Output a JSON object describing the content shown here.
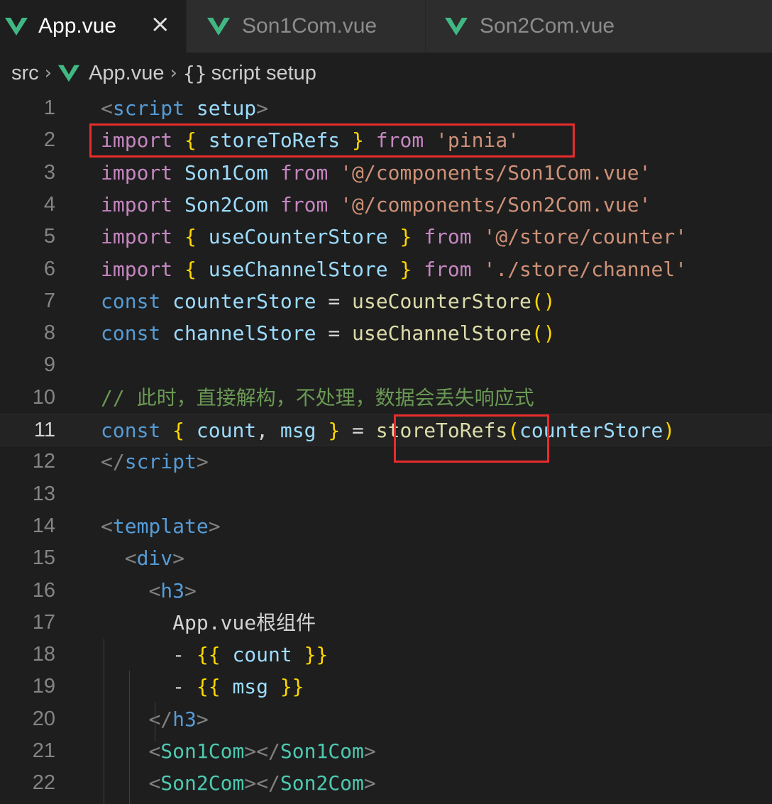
{
  "tabs": [
    {
      "label": "App.vue",
      "active": true,
      "close": "×"
    },
    {
      "label": "Son1Com.vue",
      "active": false
    },
    {
      "label": "Son2Com.vue",
      "active": false
    }
  ],
  "breadcrumb": {
    "folder": "src",
    "file": "App.vue",
    "symbol_icon": "{}",
    "symbol": "script setup"
  },
  "colors": {
    "vue_green": "#41b883",
    "highlight_box": "#e82b2b",
    "editor_bg": "#1e1e1e"
  },
  "lines": [
    {
      "n": "1",
      "tokens": [
        [
          "t-p",
          "<"
        ],
        [
          "t-tg",
          "script"
        ],
        [
          "t-tx",
          " "
        ],
        [
          "t-at",
          "setup"
        ],
        [
          "t-p",
          ">"
        ]
      ]
    },
    {
      "n": "2",
      "tokens": [
        [
          "t-kw",
          "import"
        ],
        [
          "t-tx",
          " "
        ],
        [
          "t-br",
          "{"
        ],
        [
          "t-tx",
          " "
        ],
        [
          "t-vr",
          "storeToRefs"
        ],
        [
          "t-tx",
          " "
        ],
        [
          "t-br",
          "}"
        ],
        [
          "t-tx",
          " "
        ],
        [
          "t-kw",
          "from"
        ],
        [
          "t-tx",
          " "
        ],
        [
          "t-str",
          "'pinia'"
        ]
      ]
    },
    {
      "n": "3",
      "tokens": [
        [
          "t-kw",
          "import"
        ],
        [
          "t-tx",
          " "
        ],
        [
          "t-vr",
          "Son1Com"
        ],
        [
          "t-tx",
          " "
        ],
        [
          "t-kw",
          "from"
        ],
        [
          "t-tx",
          " "
        ],
        [
          "t-str",
          "'@/components/Son1Com.vue'"
        ]
      ]
    },
    {
      "n": "4",
      "tokens": [
        [
          "t-kw",
          "import"
        ],
        [
          "t-tx",
          " "
        ],
        [
          "t-vr",
          "Son2Com"
        ],
        [
          "t-tx",
          " "
        ],
        [
          "t-kw",
          "from"
        ],
        [
          "t-tx",
          " "
        ],
        [
          "t-str",
          "'@/components/Son2Com.vue'"
        ]
      ]
    },
    {
      "n": "5",
      "tokens": [
        [
          "t-kw",
          "import"
        ],
        [
          "t-tx",
          " "
        ],
        [
          "t-br",
          "{"
        ],
        [
          "t-tx",
          " "
        ],
        [
          "t-vr",
          "useCounterStore"
        ],
        [
          "t-tx",
          " "
        ],
        [
          "t-br",
          "}"
        ],
        [
          "t-tx",
          " "
        ],
        [
          "t-kw",
          "from"
        ],
        [
          "t-tx",
          " "
        ],
        [
          "t-str",
          "'@/store/counter'"
        ]
      ]
    },
    {
      "n": "6",
      "tokens": [
        [
          "t-kw",
          "import"
        ],
        [
          "t-tx",
          " "
        ],
        [
          "t-br",
          "{"
        ],
        [
          "t-tx",
          " "
        ],
        [
          "t-vr",
          "useChannelStore"
        ],
        [
          "t-tx",
          " "
        ],
        [
          "t-br",
          "}"
        ],
        [
          "t-tx",
          " "
        ],
        [
          "t-kw",
          "from"
        ],
        [
          "t-tx",
          " "
        ],
        [
          "t-str",
          "'./store/channel'"
        ]
      ]
    },
    {
      "n": "7",
      "tokens": [
        [
          "t-cs",
          "const"
        ],
        [
          "t-tx",
          " "
        ],
        [
          "t-vr",
          "counterStore"
        ],
        [
          "t-tx",
          " "
        ],
        [
          "t-op",
          "="
        ],
        [
          "t-tx",
          " "
        ],
        [
          "t-fn",
          "useCounterStore"
        ],
        [
          "t-br",
          "()"
        ]
      ]
    },
    {
      "n": "8",
      "tokens": [
        [
          "t-cs",
          "const"
        ],
        [
          "t-tx",
          " "
        ],
        [
          "t-vr",
          "channelStore"
        ],
        [
          "t-tx",
          " "
        ],
        [
          "t-op",
          "="
        ],
        [
          "t-tx",
          " "
        ],
        [
          "t-fn",
          "useChannelStore"
        ],
        [
          "t-br",
          "()"
        ]
      ]
    },
    {
      "n": "9",
      "tokens": []
    },
    {
      "n": "10",
      "tokens": [
        [
          "t-cm",
          "// 此时，直接解构，不处理，数据会丢失响应式"
        ]
      ]
    },
    {
      "n": "11",
      "current": true,
      "tokens": [
        [
          "t-cs",
          "const"
        ],
        [
          "t-tx",
          " "
        ],
        [
          "t-br",
          "{"
        ],
        [
          "t-tx",
          " "
        ],
        [
          "t-vr",
          "count"
        ],
        [
          "t-tx",
          ", "
        ],
        [
          "t-vr",
          "msg"
        ],
        [
          "t-tx",
          " "
        ],
        [
          "t-br",
          "}"
        ],
        [
          "t-tx",
          " "
        ],
        [
          "t-op",
          "="
        ],
        [
          "t-tx",
          " "
        ],
        [
          "t-fn",
          "storeToRefs"
        ],
        [
          "t-br",
          "("
        ],
        [
          "t-vr",
          "counterStore"
        ],
        [
          "t-br",
          ")"
        ]
      ]
    },
    {
      "n": "12",
      "tokens": [
        [
          "t-p",
          "</"
        ],
        [
          "t-tg",
          "script"
        ],
        [
          "t-p",
          ">"
        ]
      ]
    },
    {
      "n": "13",
      "tokens": []
    },
    {
      "n": "14",
      "tokens": [
        [
          "t-p",
          "<"
        ],
        [
          "t-tg",
          "template"
        ],
        [
          "t-p",
          ">"
        ]
      ]
    },
    {
      "n": "15",
      "tokens": [
        [
          "t-tx",
          "  "
        ],
        [
          "t-p",
          "<"
        ],
        [
          "t-tg",
          "div"
        ],
        [
          "t-p",
          ">"
        ]
      ]
    },
    {
      "n": "16",
      "tokens": [
        [
          "t-tx",
          "    "
        ],
        [
          "t-p",
          "<"
        ],
        [
          "t-tg",
          "h3"
        ],
        [
          "t-p",
          ">"
        ]
      ]
    },
    {
      "n": "17",
      "tokens": [
        [
          "t-tx",
          "      App.vue根组件"
        ]
      ]
    },
    {
      "n": "18",
      "tokens": [
        [
          "t-tx",
          "      - "
        ],
        [
          "t-br",
          "{{"
        ],
        [
          "t-tx",
          " "
        ],
        [
          "t-vr",
          "count"
        ],
        [
          "t-tx",
          " "
        ],
        [
          "t-br",
          "}}"
        ]
      ]
    },
    {
      "n": "19",
      "tokens": [
        [
          "t-tx",
          "      - "
        ],
        [
          "t-br",
          "{{"
        ],
        [
          "t-tx",
          " "
        ],
        [
          "t-vr",
          "msg"
        ],
        [
          "t-tx",
          " "
        ],
        [
          "t-br",
          "}}"
        ]
      ]
    },
    {
      "n": "20",
      "tokens": [
        [
          "t-tx",
          "    "
        ],
        [
          "t-p",
          "</"
        ],
        [
          "t-tg",
          "h3"
        ],
        [
          "t-p",
          ">"
        ]
      ]
    },
    {
      "n": "21",
      "tokens": [
        [
          "t-tx",
          "    "
        ],
        [
          "t-p",
          "<"
        ],
        [
          "t-cp",
          "Son1Com"
        ],
        [
          "t-p",
          "></"
        ],
        [
          "t-cp",
          "Son1Com"
        ],
        [
          "t-p",
          ">"
        ]
      ]
    },
    {
      "n": "22",
      "tokens": [
        [
          "t-tx",
          "    "
        ],
        [
          "t-p",
          "<"
        ],
        [
          "t-cp",
          "Son2Com"
        ],
        [
          "t-p",
          "></"
        ],
        [
          "t-cp",
          "Son2Com"
        ],
        [
          "t-p",
          ">"
        ]
      ]
    }
  ]
}
